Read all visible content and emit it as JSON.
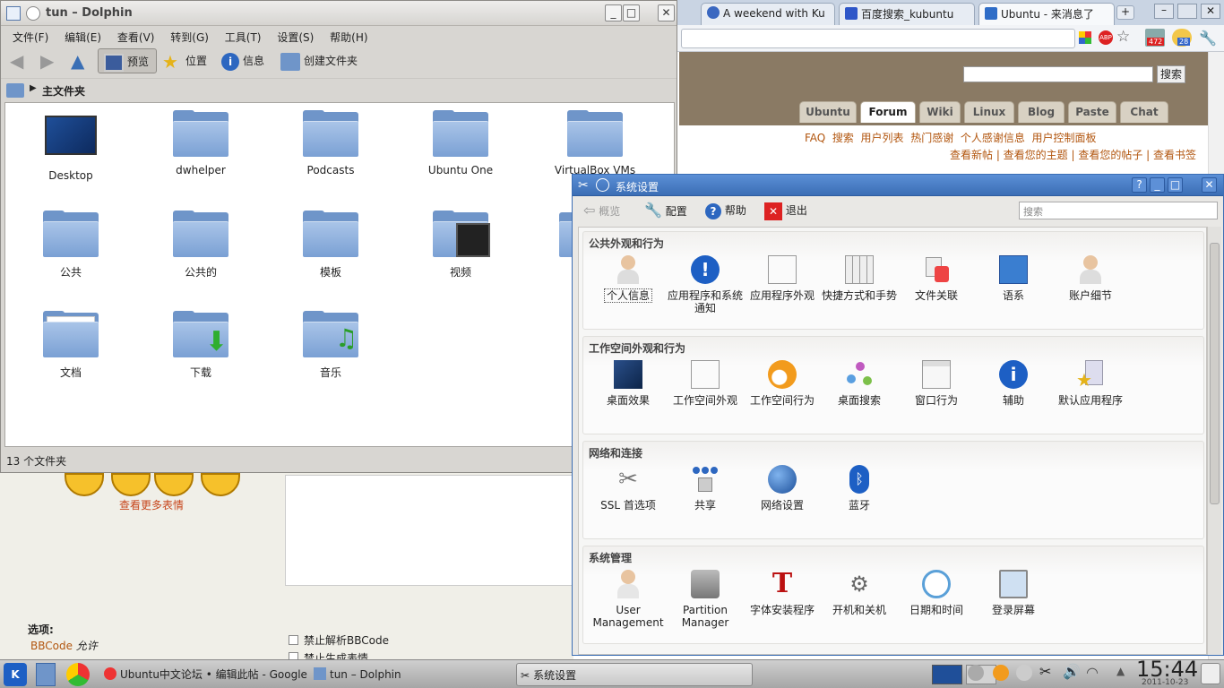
{
  "chrome": {
    "tabs": [
      {
        "label": "A weekend with Ku",
        "fav_color": "#3a67c0"
      },
      {
        "label": "百度搜索_kubuntu",
        "fav_color": "#2e56c8"
      },
      {
        "label": "Ubuntu - 来消息了",
        "fav_color": "#2f6dc7"
      }
    ],
    "badges": [
      "472",
      "28"
    ],
    "forum": {
      "search_button": "搜索",
      "tabs": [
        "Ubuntu",
        "Forum",
        "Wiki",
        "Linux",
        "Blog",
        "Paste",
        "Chat"
      ],
      "active_tab": "Forum",
      "links_row1": [
        "FAQ",
        "搜索",
        "用户列表",
        "热门感谢",
        "个人感谢信息",
        "用户控制面板"
      ],
      "links_row2": "查看新帖 | 查看您的主题 | 查看您的帖子 | 查看书签",
      "more_faces": "查看更多表情",
      "options_title": "选项:",
      "bbcode_link": "BBCode",
      "bbcode_status": "允许",
      "checkbox_disable_bbcode": "禁止解析BBCode",
      "checkbox_partial": "禁止生成表情"
    }
  },
  "dolphin": {
    "title": "tun – Dolphin",
    "menu": [
      "文件(F)",
      "编辑(E)",
      "查看(V)",
      "转到(G)",
      "工具(T)",
      "设置(S)",
      "帮助(H)"
    ],
    "toolbar": {
      "preview": "预览",
      "places": "位置",
      "info": "信息",
      "new_folder": "创建文件夹"
    },
    "path": "主文件夹",
    "items": [
      "Desktop",
      "dwhelper",
      "Podcasts",
      "Ubuntu One",
      "VirtualBox VMs",
      "公共",
      "公共的",
      "模板",
      "视频",
      "文档",
      "下载",
      "音乐"
    ],
    "status": "13 个文件夹"
  },
  "settings": {
    "title": "系统设置",
    "toolbar": {
      "overview": "概览",
      "configure": "配置",
      "help": "帮助",
      "quit": "退出",
      "search_placeholder": "搜索"
    },
    "sections": [
      {
        "title": "公共外观和行为",
        "items": [
          "个人信息",
          "应用程序和系统通知",
          "应用程序外观",
          "快捷方式和手势",
          "文件关联",
          "语系",
          "账户细节"
        ]
      },
      {
        "title": "工作空间外观和行为",
        "items": [
          "桌面效果",
          "工作空间外观",
          "工作空间行为",
          "桌面搜索",
          "窗口行为",
          "辅助",
          "默认应用程序"
        ]
      },
      {
        "title": "网络和连接",
        "items": [
          "SSL 首选项",
          "共享",
          "网络设置",
          "蓝牙"
        ]
      },
      {
        "title": "系统管理",
        "items": [
          "User Management",
          "Partition Manager",
          "字体安装程序",
          "开机和关机",
          "日期和时间",
          "登录屏幕"
        ]
      }
    ]
  },
  "taskbar": {
    "tasks": [
      "Ubuntu中文论坛 • 编辑此帖 - Google Chrome",
      "tun – Dolphin",
      "系统设置"
    ],
    "clock": "15:44",
    "date": "2011-10-23"
  }
}
